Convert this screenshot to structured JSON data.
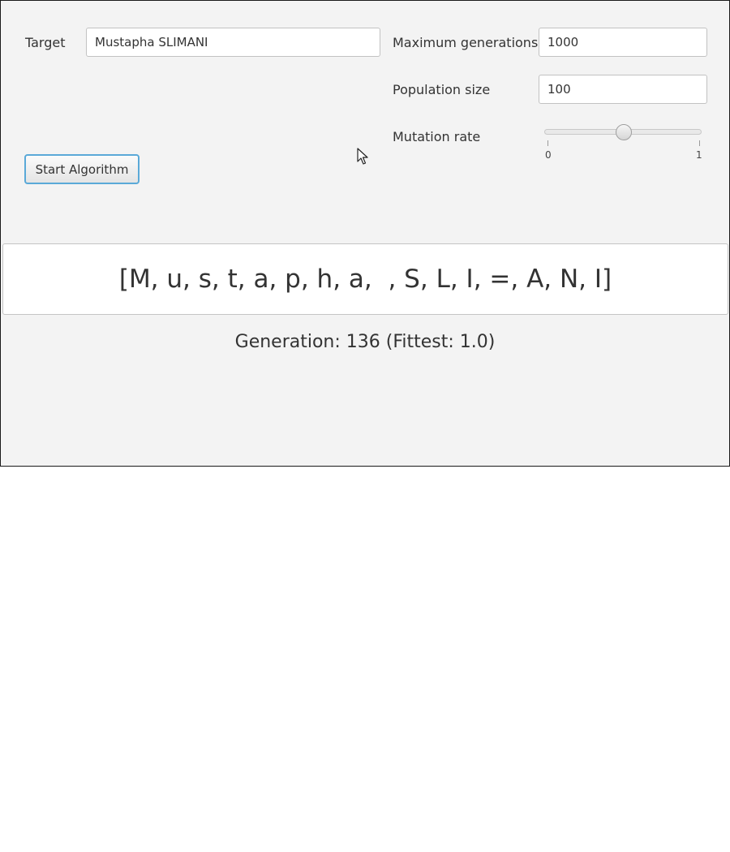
{
  "form": {
    "target_label": "Target",
    "target_value": "Mustapha SLIMANI",
    "max_generations_label": "Maximum generations",
    "max_generations_value": "1000",
    "population_size_label": "Population size",
    "population_size_value": "100",
    "mutation_rate_label": "Mutation rate",
    "mutation_rate_value": 0.5,
    "mutation_rate_min_label": "0",
    "mutation_rate_max_label": "1",
    "start_button_label": "Start Algorithm"
  },
  "result": {
    "current_chromosome": "[M, u, s, t, a, p, h, a,  , S, L, I, =, A, N, I]",
    "generation_status": "Generation: 136 (Fittest: 1.0)"
  },
  "colors": {
    "window_background": "#f3f3f3",
    "button_focus_border": "#5aa9d8"
  },
  "icons": {
    "cursor": "mouse-pointer-icon"
  }
}
